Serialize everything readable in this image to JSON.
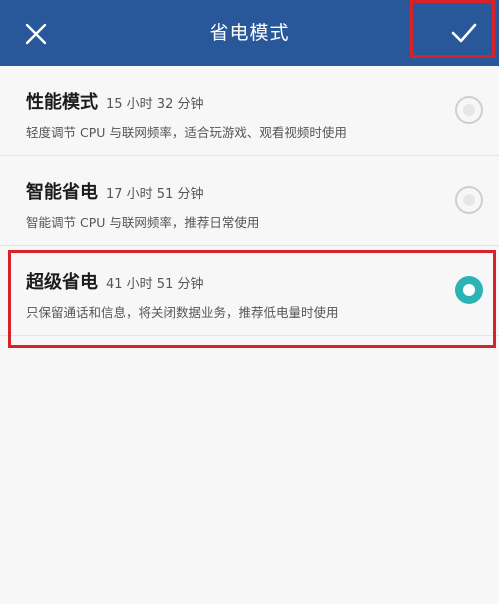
{
  "header": {
    "title": "省电模式",
    "close_icon": "close-icon",
    "confirm_icon": "check-icon",
    "background_color": "#28579a"
  },
  "options": [
    {
      "name": "性能模式",
      "time": "15 小时 32 分钟",
      "desc": "轻度调节 CPU 与联网频率，适合玩游戏、观看视频时使用",
      "selected": false
    },
    {
      "name": "智能省电",
      "time": "17 小时 51 分钟",
      "desc": "智能调节 CPU 与联网频率，推荐日常使用",
      "selected": false
    },
    {
      "name": "超级省电",
      "time": "41 小时 51 分钟",
      "desc": "只保留通话和信息，将关闭数据业务，推荐低电量时使用",
      "selected": true
    }
  ],
  "colors": {
    "accent_radio": "#2cb4b4",
    "highlight_box": "#d8222a"
  }
}
